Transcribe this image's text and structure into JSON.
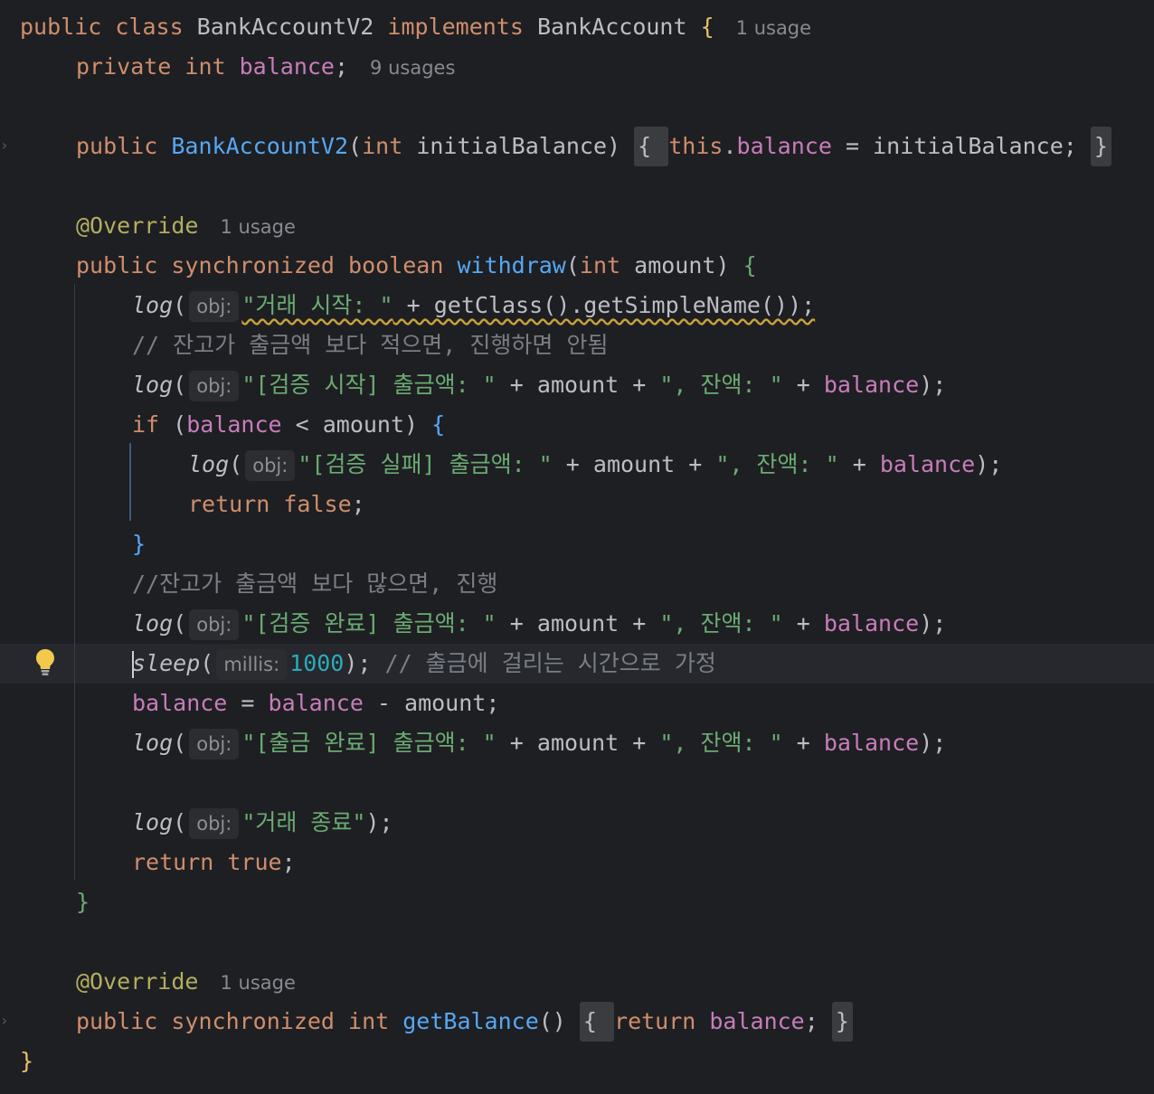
{
  "editor": {
    "lines": [
      {
        "segs": [
          [
            "kw",
            "public class "
          ],
          [
            "name",
            "BankAccountV2 "
          ],
          [
            "kw",
            "implements "
          ],
          [
            "name",
            "BankAccount "
          ],
          [
            "brace-y",
            "{"
          ]
        ],
        "usage": "1 usage"
      },
      {
        "segs": [
          [
            "kw",
            "private int "
          ],
          [
            "field",
            "balance"
          ],
          [
            "name",
            ";"
          ]
        ],
        "usage": "9 usages"
      },
      {
        "segs": []
      },
      {
        "segs": [
          [
            "kw",
            "public "
          ],
          [
            "fn",
            "BankAccountV2"
          ],
          [
            "name",
            "("
          ],
          [
            "kw",
            "int "
          ],
          [
            "name",
            "initialBalance) "
          ]
        ],
        "fold_start": "{ ",
        "after": [
          [
            "kw",
            "this"
          ],
          [
            "name",
            "."
          ],
          [
            "field",
            "balance"
          ],
          [
            "name",
            " = initialBalance; "
          ]
        ],
        "fold_end": "}"
      },
      {
        "segs": []
      },
      {
        "segs": [
          [
            "ann",
            "@Override"
          ]
        ],
        "usage": "1 usage"
      },
      {
        "segs": [
          [
            "kw",
            "public synchronized boolean "
          ],
          [
            "fn",
            "withdraw"
          ],
          [
            "name",
            "("
          ],
          [
            "kw",
            "int "
          ],
          [
            "name",
            "amount) "
          ],
          [
            "brace-g",
            "{"
          ]
        ]
      },
      {
        "segs": [
          [
            "italic",
            "log"
          ],
          [
            "name",
            "("
          ]
        ],
        "hint": "obj:",
        "rest": [
          [
            "str",
            "\"거래 시작: \""
          ],
          [
            "name",
            " + getClass().getSimpleName());"
          ]
        ],
        "squiggle": true
      },
      {
        "segs": [
          [
            "cm",
            "// 잔고가 출금액 보다 적으면, 진행하면 안됨"
          ]
        ]
      },
      {
        "segs": [
          [
            "italic",
            "log"
          ],
          [
            "name",
            "("
          ]
        ],
        "hint": "obj:",
        "rest": [
          [
            "str",
            "\"[검증 시작] 출금액: \""
          ],
          [
            "name",
            " + amount + "
          ],
          [
            "str",
            "\", 잔액: \""
          ],
          [
            "name",
            " + "
          ],
          [
            "field",
            "balance"
          ],
          [
            "name",
            ");"
          ]
        ]
      },
      {
        "segs": [
          [
            "kw",
            "if "
          ],
          [
            "name",
            "("
          ],
          [
            "field",
            "balance"
          ],
          [
            "name",
            " < amount) "
          ],
          [
            "brace-b",
            "{"
          ]
        ]
      },
      {
        "segs": [
          [
            "italic",
            "log"
          ],
          [
            "name",
            "("
          ]
        ],
        "hint": "obj:",
        "rest": [
          [
            "str",
            "\"[검증 실패] 출금액: \""
          ],
          [
            "name",
            " + amount + "
          ],
          [
            "str",
            "\", 잔액: \""
          ],
          [
            "name",
            " + "
          ],
          [
            "field",
            "balance"
          ],
          [
            "name",
            ");"
          ]
        ]
      },
      {
        "segs": [
          [
            "kw",
            "return false"
          ],
          [
            "name",
            ";"
          ]
        ]
      },
      {
        "segs": [
          [
            "brace-b",
            "}"
          ]
        ]
      },
      {
        "segs": [
          [
            "cm",
            "//잔고가 출금액 보다 많으면, 진행"
          ]
        ]
      },
      {
        "segs": [
          [
            "italic",
            "log"
          ],
          [
            "name",
            "("
          ]
        ],
        "hint": "obj:",
        "rest": [
          [
            "str",
            "\"[검증 완료] 출금액: \""
          ],
          [
            "name",
            " + amount + "
          ],
          [
            "str",
            "\", 잔액: \""
          ],
          [
            "name",
            " + "
          ],
          [
            "field",
            "balance"
          ],
          [
            "name",
            ");"
          ]
        ]
      },
      {
        "segs": [
          [
            "italic",
            "sleep"
          ],
          [
            "name",
            "("
          ]
        ],
        "hint": "millis:",
        "rest": [
          [
            "num",
            "1000"
          ],
          [
            "name",
            "); "
          ],
          [
            "cm",
            "// 출금에 걸리는 시간으로 가정"
          ]
        ]
      },
      {
        "segs": [
          [
            "field",
            "balance"
          ],
          [
            "name",
            " = "
          ],
          [
            "field",
            "balance"
          ],
          [
            "name",
            " - amount;"
          ]
        ]
      },
      {
        "segs": [
          [
            "italic",
            "log"
          ],
          [
            "name",
            "("
          ]
        ],
        "hint": "obj:",
        "rest": [
          [
            "str",
            "\"[출금 완료] 출금액: \""
          ],
          [
            "name",
            " + amount + "
          ],
          [
            "str",
            "\", 잔액: \""
          ],
          [
            "name",
            " + "
          ],
          [
            "field",
            "balance"
          ],
          [
            "name",
            ");"
          ]
        ]
      },
      {
        "segs": []
      },
      {
        "segs": [
          [
            "italic",
            "log"
          ],
          [
            "name",
            "("
          ]
        ],
        "hint": "obj:",
        "rest": [
          [
            "str",
            "\"거래 종료\""
          ],
          [
            "name",
            ");"
          ]
        ]
      },
      {
        "segs": [
          [
            "kw",
            "return true"
          ],
          [
            "name",
            ";"
          ]
        ]
      },
      {
        "segs": [
          [
            "brace-g",
            "}"
          ]
        ]
      },
      {
        "segs": []
      },
      {
        "segs": [
          [
            "ann",
            "@Override"
          ]
        ],
        "usage": "1 usage"
      },
      {
        "segs": [
          [
            "kw",
            "public synchronized int "
          ],
          [
            "fn",
            "getBalance"
          ],
          [
            "name",
            "() "
          ]
        ],
        "fold_start": "{ ",
        "after": [
          [
            "kw",
            "return "
          ],
          [
            "field",
            "balance"
          ],
          [
            "name",
            "; "
          ]
        ],
        "fold_end": "}"
      },
      {
        "segs": [
          [
            "brace-y",
            "}"
          ]
        ]
      }
    ]
  },
  "colors": {
    "background": "#1e1f22",
    "keyword": "#cf8e6d",
    "field": "#c77dbb",
    "function": "#56a8f5",
    "string": "#6aab73",
    "number": "#2aacb8",
    "annotation": "#b3ae60",
    "comment": "#7a7e85"
  },
  "icons": {
    "intention": "lightbulb-icon",
    "fold": "chevron-right-icon"
  }
}
